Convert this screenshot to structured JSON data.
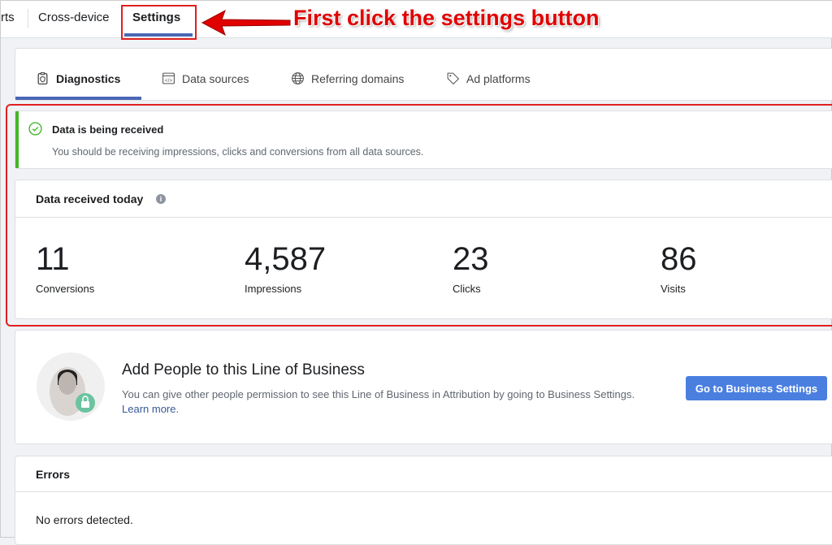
{
  "topnav": {
    "items": [
      {
        "label": "rts"
      },
      {
        "label": "Cross-device"
      },
      {
        "label": "Settings",
        "active": true
      }
    ]
  },
  "annotation": {
    "text": "First click the settings button",
    "color": "#e00000"
  },
  "tabs": [
    {
      "label": "Diagnostics",
      "icon": "clipboard-shield-icon",
      "active": true
    },
    {
      "label": "Data sources",
      "icon": "code-window-icon"
    },
    {
      "label": "Referring domains",
      "icon": "globe-icon"
    },
    {
      "label": "Ad platforms",
      "icon": "tag-icon"
    }
  ],
  "status": {
    "title": "Data is being received",
    "message": "You should be receiving impressions, clicks and conversions from all data sources.",
    "icon": "check-circle-icon",
    "color": "#42b72a"
  },
  "data_today": {
    "title": "Data received today",
    "metrics": [
      {
        "value": "11",
        "label": "Conversions"
      },
      {
        "value": "4,587",
        "label": "Impressions"
      },
      {
        "value": "23",
        "label": "Clicks"
      },
      {
        "value": "86",
        "label": "Visits"
      }
    ]
  },
  "add_people": {
    "title": "Add People to this Line of Business",
    "text": "You can give other people permission to see this Line of Business in Attribution by going to Business Settings.",
    "link": "Learn more.",
    "button": "Go to Business Settings"
  },
  "errors": {
    "title": "Errors",
    "message": "No errors detected."
  }
}
